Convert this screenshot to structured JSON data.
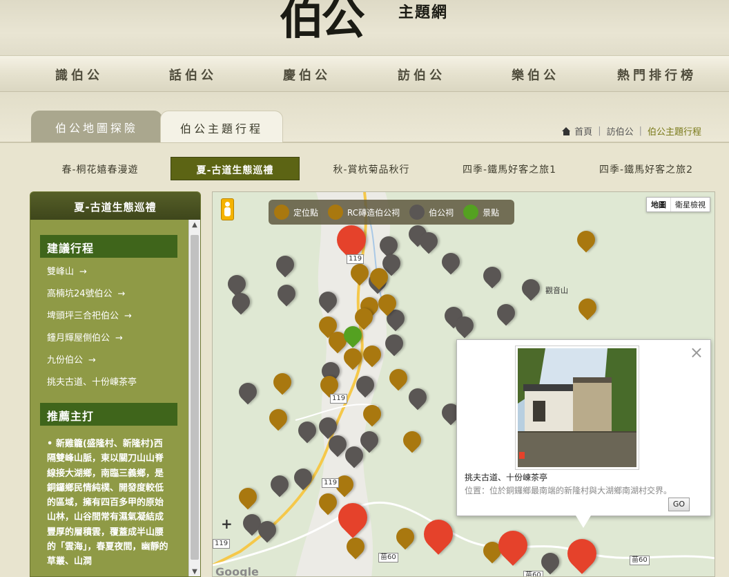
{
  "site": {
    "logo_big": "伯公",
    "logo_small": "主題網"
  },
  "nav": [
    "識伯公",
    "話伯公",
    "慶伯公",
    "訪伯公",
    "樂伯公",
    "熱門排行榜"
  ],
  "page_tabs": [
    "伯公地圖探險",
    "伯公主題行程"
  ],
  "breadcrumb": {
    "home": "首頁",
    "level2": "訪伯公",
    "current": "伯公主題行程"
  },
  "season_tabs": [
    "春-桐花嬉春漫遊",
    "夏-古道生態巡禮",
    "秋-賞杭菊品秋行",
    "四季-鐵馬好客之旅1",
    "四季-鐵馬好客之旅2"
  ],
  "panel": {
    "title": "夏-古道生態巡禮",
    "section1": "建議行程",
    "route": [
      "雙峰山",
      "高楠坑24號伯公",
      "埤頭坪三合祀伯公",
      "鍾月輝屋側伯公",
      "九份伯公",
      "挑夫古道、十份崠茶亭"
    ],
    "arrow": "→",
    "section2": "推薦主打",
    "recommend": "• 新雞籠(盛隆村、新隆村)西隔雙峰山脈，東以關刀山山脊線接大湖鄉，南臨三義鄉，是銅鑼鄉民情純樸、開發度較低的區域，擁有四百多甲的原始山林，山谷間常有濕氣凝結成豐厚的層積雲，覆蓋成半山腰的「雲海」，春夏夜間，幽靜的草叢、山澗"
  },
  "map": {
    "legend": [
      "定位點",
      "RC磚造伯公祠",
      "伯公祠",
      "景點"
    ],
    "toggle": [
      "地圖",
      "衛星檢視"
    ],
    "road_labels": [
      "119",
      "119",
      "119",
      "119",
      "苗60",
      "苗60",
      "苗60"
    ],
    "poi": "觀音山",
    "zoom": "+",
    "watermark": "Google",
    "colors": {
      "grey": "#5a5654",
      "gold": "#a9780f",
      "red": "#e5422b",
      "green": "#54a121"
    }
  },
  "popup": {
    "title": "挑夫古道、十份崠茶亭",
    "location": "位置：位於銅鑼鄉最南端的新隆村與大湖鄉南湖村交界。",
    "go": "GO",
    "close": "×"
  }
}
